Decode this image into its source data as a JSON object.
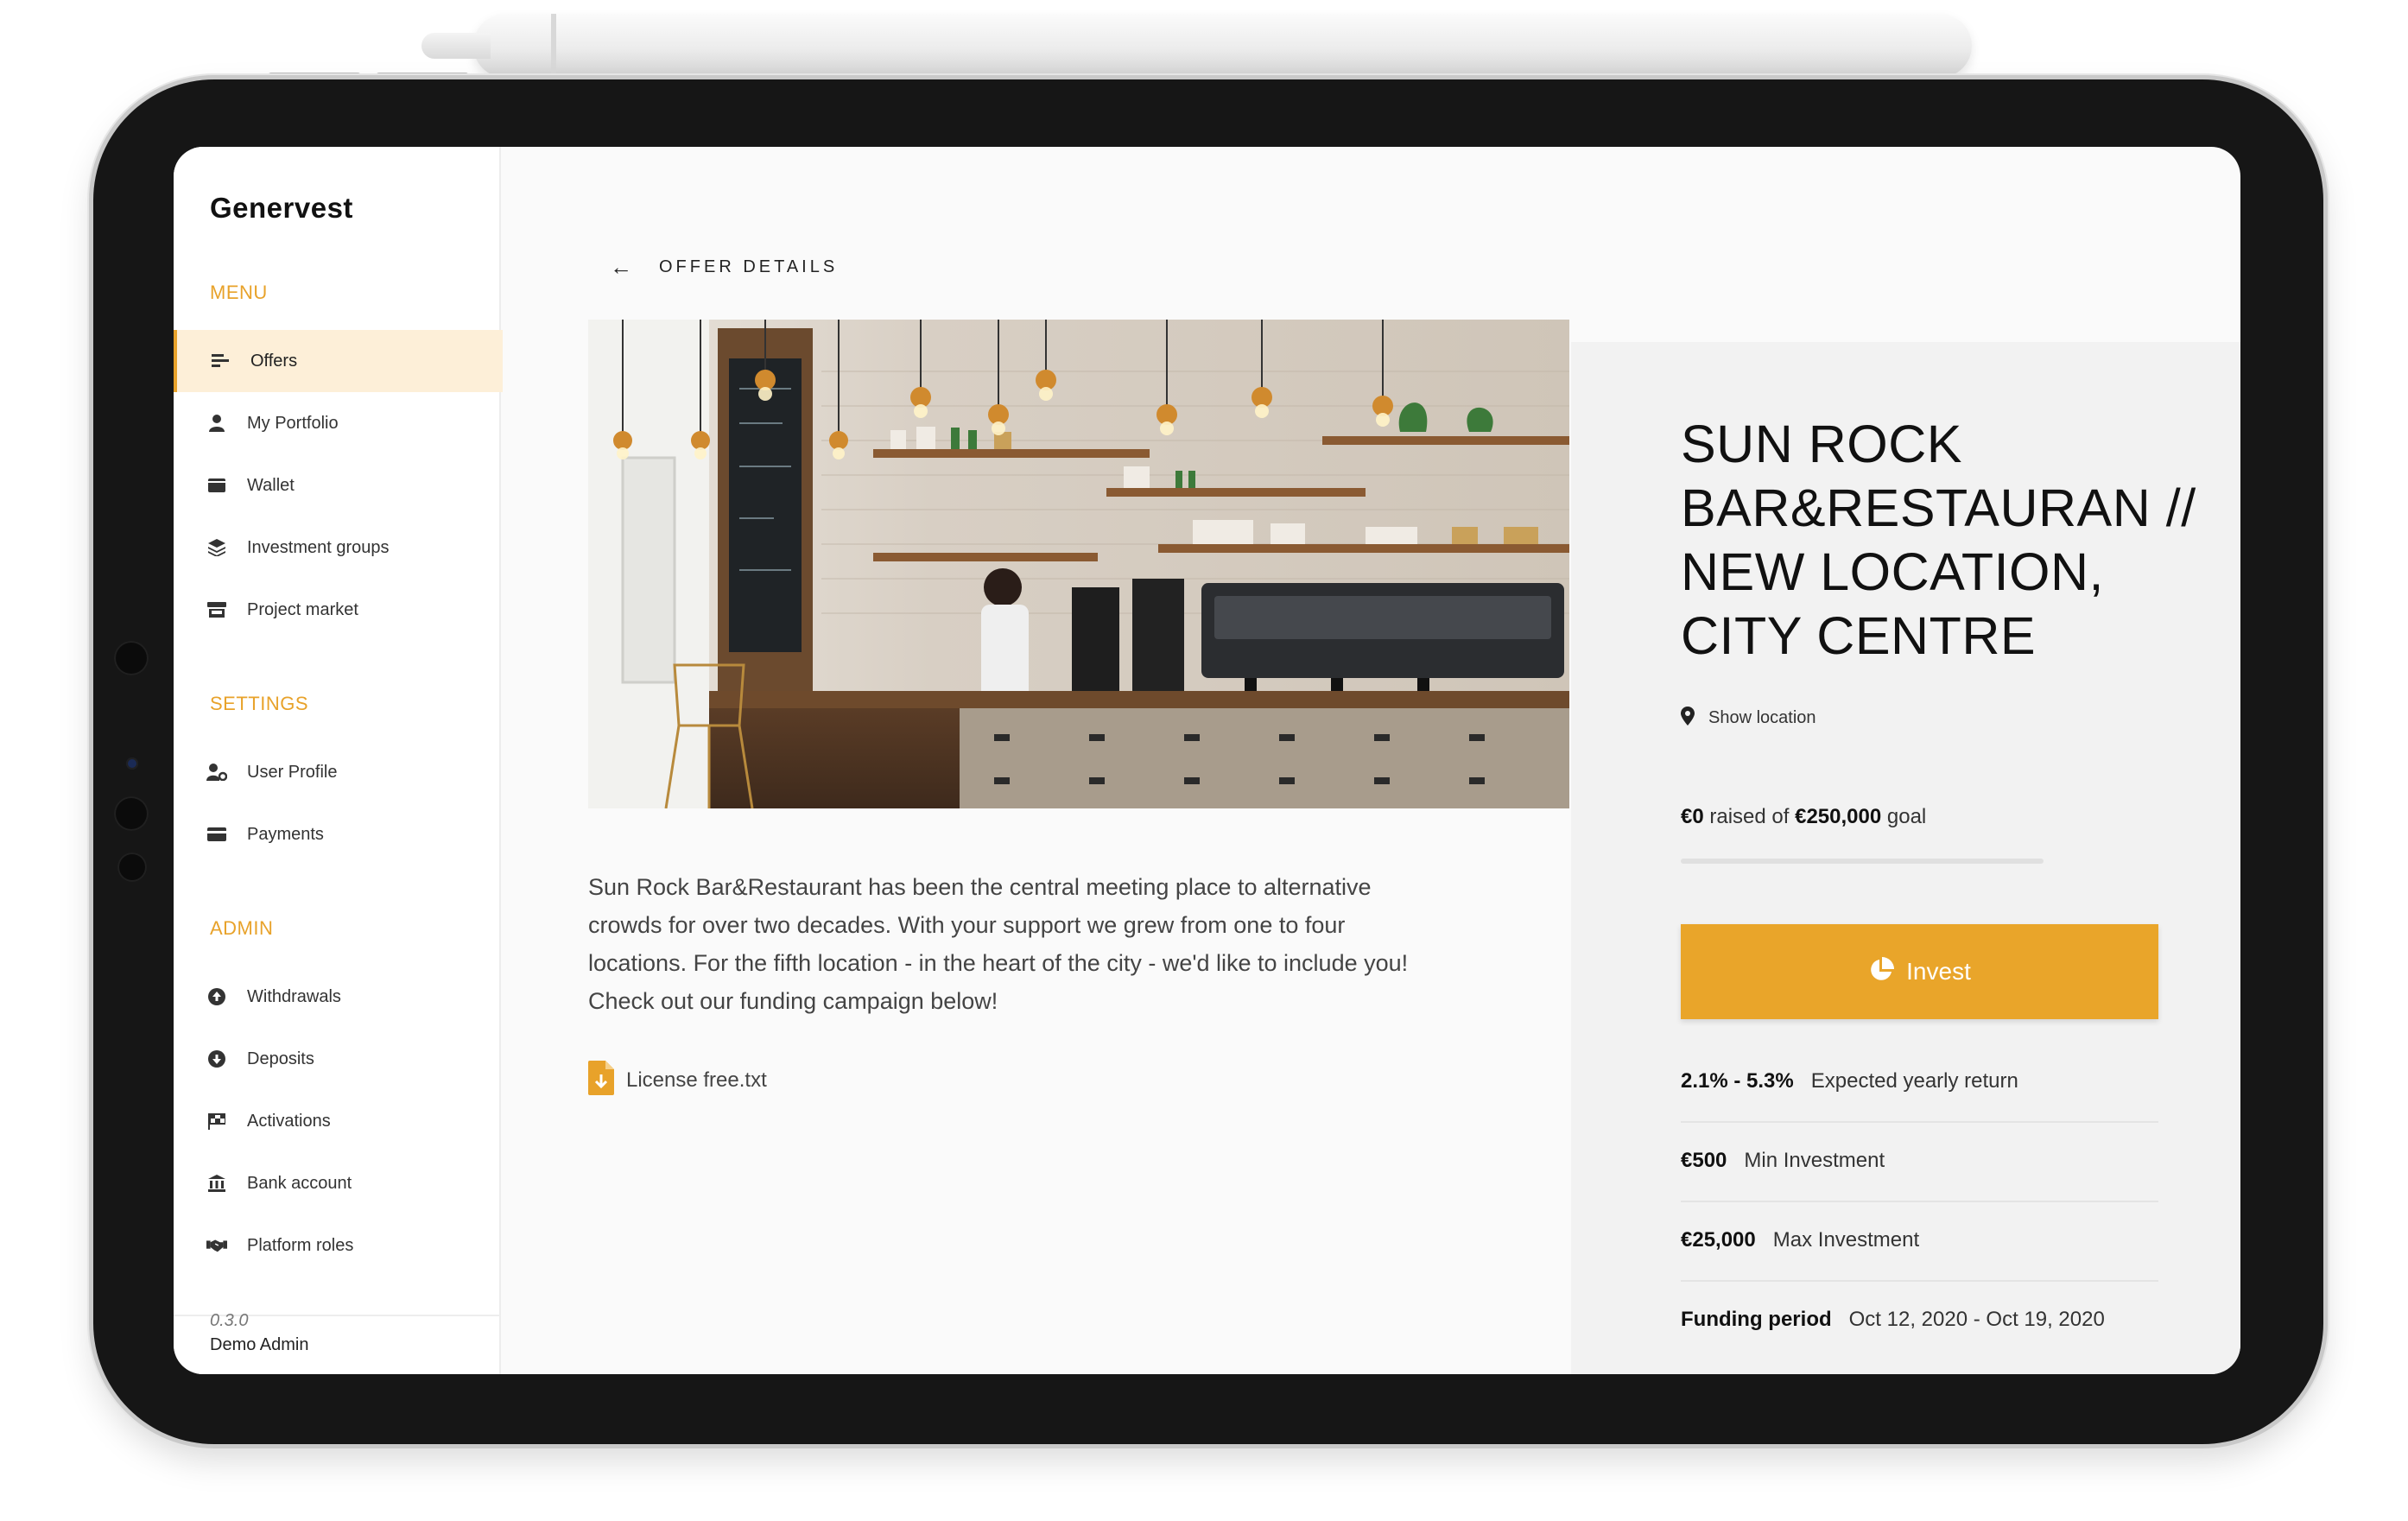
{
  "app": {
    "brand": "Genervest",
    "version": "0.3.0",
    "user": "Demo Admin"
  },
  "sidebar": {
    "menu_title": "MENU",
    "menu": [
      {
        "label": "Offers",
        "icon": "list-icon",
        "active": true
      },
      {
        "label": "My Portfolio",
        "icon": "user-icon"
      },
      {
        "label": "Wallet",
        "icon": "wallet-icon"
      },
      {
        "label": "Investment groups",
        "icon": "layers-icon"
      },
      {
        "label": "Project market",
        "icon": "store-icon"
      }
    ],
    "settings_title": "SETTINGS",
    "settings": [
      {
        "label": "User Profile",
        "icon": "user-cog-icon"
      },
      {
        "label": "Payments",
        "icon": "credit-card-icon"
      }
    ],
    "admin_title": "ADMIN",
    "admin": [
      {
        "label": "Withdrawals",
        "icon": "arrow-up-circle-icon"
      },
      {
        "label": "Deposits",
        "icon": "arrow-down-circle-icon"
      },
      {
        "label": "Activations",
        "icon": "flag-checkered-icon"
      },
      {
        "label": "Bank account",
        "icon": "bank-icon"
      },
      {
        "label": "Platform roles",
        "icon": "handshake-icon"
      }
    ]
  },
  "header": {
    "title": "OFFER DETAILS"
  },
  "offer": {
    "title": "SUN ROCK BAR&RESTAURAN // NEW LOCATION, CITY CENTRE",
    "location_label": "Show location",
    "raised_amount": "€0",
    "raised_mid": "raised of",
    "goal_amount": "€250,000",
    "goal_suffix": "goal",
    "progress_fraction": 0,
    "description": "Sun Rock Bar&Restaurant has been the central meeting place to alternative crowds for over two decades. With your support we grew from one to four locations. For the fifth location - in the heart of the city - we'd like to include you! Check out our funding campaign below!",
    "attachment": "License free.txt",
    "invest_label": "Invest",
    "stats": [
      {
        "value": "2.1% - 5.3%",
        "label": "Expected yearly return"
      },
      {
        "value": "€500",
        "label": "Min Investment"
      },
      {
        "value": "€25,000",
        "label": "Max Investment"
      },
      {
        "value": "Funding period",
        "label": "Oct 12, 2020 - Oct 19, 2020"
      }
    ]
  },
  "colors": {
    "accent": "#e8a22a",
    "active_bg": "#fdefd8",
    "panel_bg": "#f2f2f2"
  }
}
